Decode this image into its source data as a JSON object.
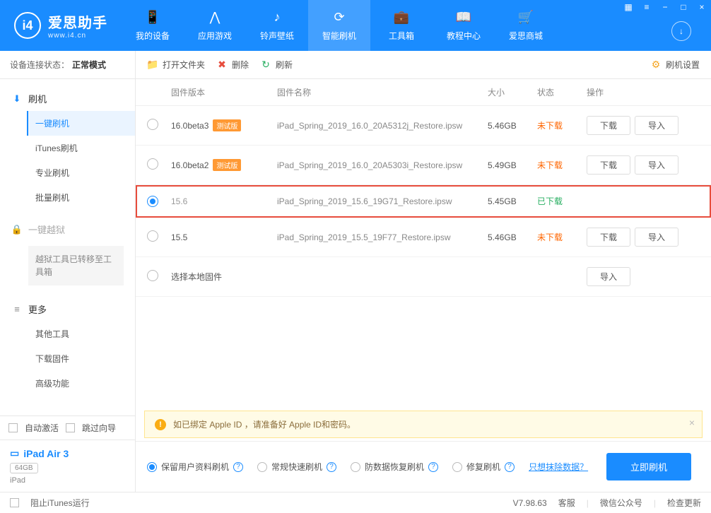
{
  "app": {
    "name": "爱思助手",
    "url": "www.i4.cn"
  },
  "nav": [
    {
      "label": "我的设备",
      "icon": "phone"
    },
    {
      "label": "应用游戏",
      "icon": "apps"
    },
    {
      "label": "铃声壁纸",
      "icon": "music"
    },
    {
      "label": "智能刷机",
      "icon": "refresh",
      "active": true
    },
    {
      "label": "工具箱",
      "icon": "toolbox"
    },
    {
      "label": "教程中心",
      "icon": "book"
    },
    {
      "label": "爱思商城",
      "icon": "cart"
    }
  ],
  "status": {
    "label": "设备连接状态：",
    "value": "正常模式"
  },
  "menu": {
    "flash": {
      "title": "刷机",
      "items": [
        "一键刷机",
        "iTunes刷机",
        "专业刷机",
        "批量刷机"
      ],
      "active": 0
    },
    "jailbreak": {
      "title": "一键越狱",
      "note": "越狱工具已转移至工具箱"
    },
    "more": {
      "title": "更多",
      "items": [
        "其他工具",
        "下载固件",
        "高级功能"
      ]
    }
  },
  "sidebar_bottom": {
    "auto_activate": "自动激活",
    "skip_guide": "跳过向导"
  },
  "device": {
    "name": "iPad Air 3",
    "storage": "64GB",
    "type": "iPad"
  },
  "toolbar": {
    "open": "打开文件夹",
    "delete": "删除",
    "refresh": "刷新",
    "settings": "刷机设置"
  },
  "table": {
    "headers": {
      "version": "固件版本",
      "name": "固件名称",
      "size": "大小",
      "status": "状态",
      "ops": "操作"
    },
    "rows": [
      {
        "version": "16.0beta3",
        "beta": "测试版",
        "name": "iPad_Spring_2019_16.0_20A5312j_Restore.ipsw",
        "size": "5.46GB",
        "status": "未下载",
        "status_cls": "un",
        "selected": false,
        "ops": [
          "下载",
          "导入"
        ]
      },
      {
        "version": "16.0beta2",
        "beta": "测试版",
        "name": "iPad_Spring_2019_16.0_20A5303i_Restore.ipsw",
        "size": "5.49GB",
        "status": "未下载",
        "status_cls": "un",
        "selected": false,
        "ops": [
          "下载",
          "导入"
        ]
      },
      {
        "version": "15.6",
        "beta": "",
        "name": "iPad_Spring_2019_15.6_19G71_Restore.ipsw",
        "size": "5.45GB",
        "status": "已下载",
        "status_cls": "ok",
        "selected": true,
        "highlight": true,
        "ops": []
      },
      {
        "version": "15.5",
        "beta": "",
        "name": "iPad_Spring_2019_15.5_19F77_Restore.ipsw",
        "size": "5.46GB",
        "status": "未下载",
        "status_cls": "un",
        "selected": false,
        "ops": [
          "下载",
          "导入"
        ]
      },
      {
        "version": "选择本地固件",
        "beta": "",
        "name": "",
        "size": "",
        "status": "",
        "status_cls": "",
        "selected": false,
        "ops": [
          "导入"
        ]
      }
    ]
  },
  "notice": "如已绑定 Apple ID ，请准备好 Apple ID和密码。",
  "options": {
    "items": [
      "保留用户资料刷机",
      "常规快速刷机",
      "防数据恢复刷机",
      "修复刷机"
    ],
    "selected": 0,
    "erase_link": "只想抹除数据？",
    "primary": "立即刷机"
  },
  "footer": {
    "block_itunes": "阻止iTunes运行",
    "version": "V7.98.63",
    "service": "客服",
    "wechat": "微信公众号",
    "update": "检查更新"
  }
}
